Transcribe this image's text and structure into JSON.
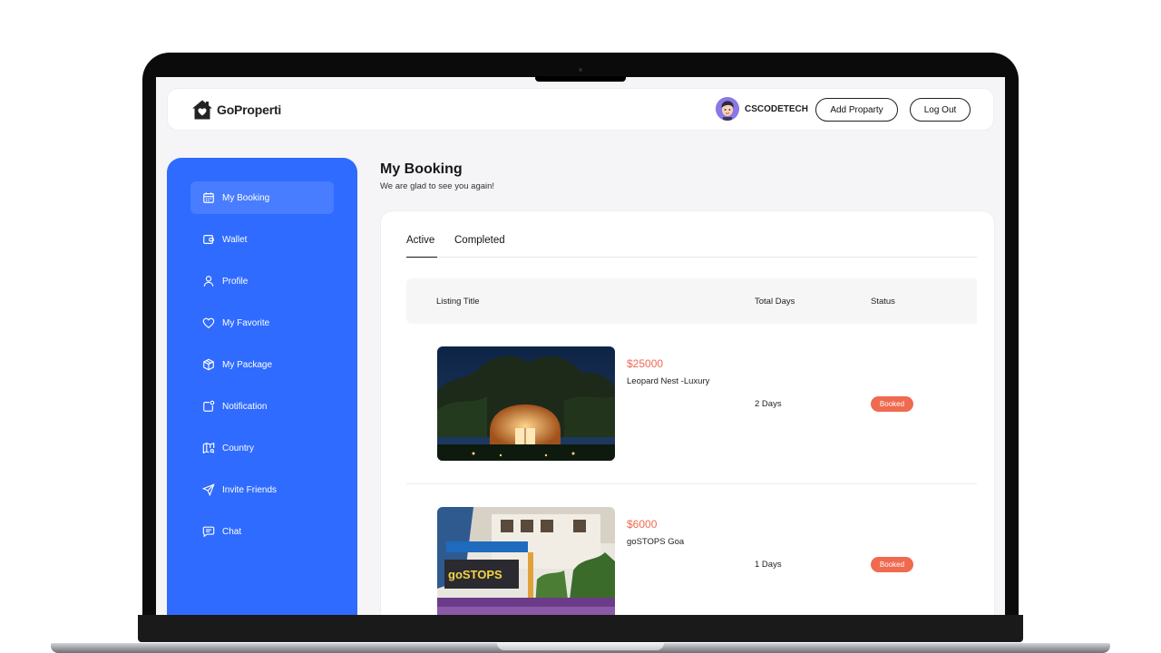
{
  "app": {
    "name": "GoProperti"
  },
  "header": {
    "username": "CSCODETECH",
    "add_property_label": "Add Proparty",
    "logout_label": "Log Out"
  },
  "sidebar": {
    "items": [
      {
        "label": "My Booking",
        "icon": "calendar-icon",
        "active": true
      },
      {
        "label": "Wallet",
        "icon": "wallet-icon"
      },
      {
        "label": "Profile",
        "icon": "user-icon"
      },
      {
        "label": "My Favorite",
        "icon": "heart-icon"
      },
      {
        "label": "My Package",
        "icon": "package-icon"
      },
      {
        "label": "Notification",
        "icon": "notification-icon"
      },
      {
        "label": "Country",
        "icon": "map-icon"
      },
      {
        "label": "Invite Friends",
        "icon": "send-icon"
      },
      {
        "label": "Chat",
        "icon": "chat-icon"
      }
    ]
  },
  "page": {
    "title": "My Booking",
    "subtitle": "We are glad to see you again!"
  },
  "tabs": [
    {
      "label": "Active",
      "active": true
    },
    {
      "label": "Completed",
      "active": false
    }
  ],
  "table": {
    "columns": [
      "Listing Title",
      "Total Days",
      "Status"
    ],
    "rows": [
      {
        "price": "$25000",
        "title": "Leopard Nest -Luxury",
        "days": "2 Days",
        "status": "Booked"
      },
      {
        "price": "$6000",
        "title": "goSTOPS Goa",
        "days": "1 Days",
        "status": "Booked"
      }
    ]
  },
  "colors": {
    "accent": "#2f6bff",
    "status_booked": "#ef6a4f",
    "price": "#ef6a4f"
  }
}
